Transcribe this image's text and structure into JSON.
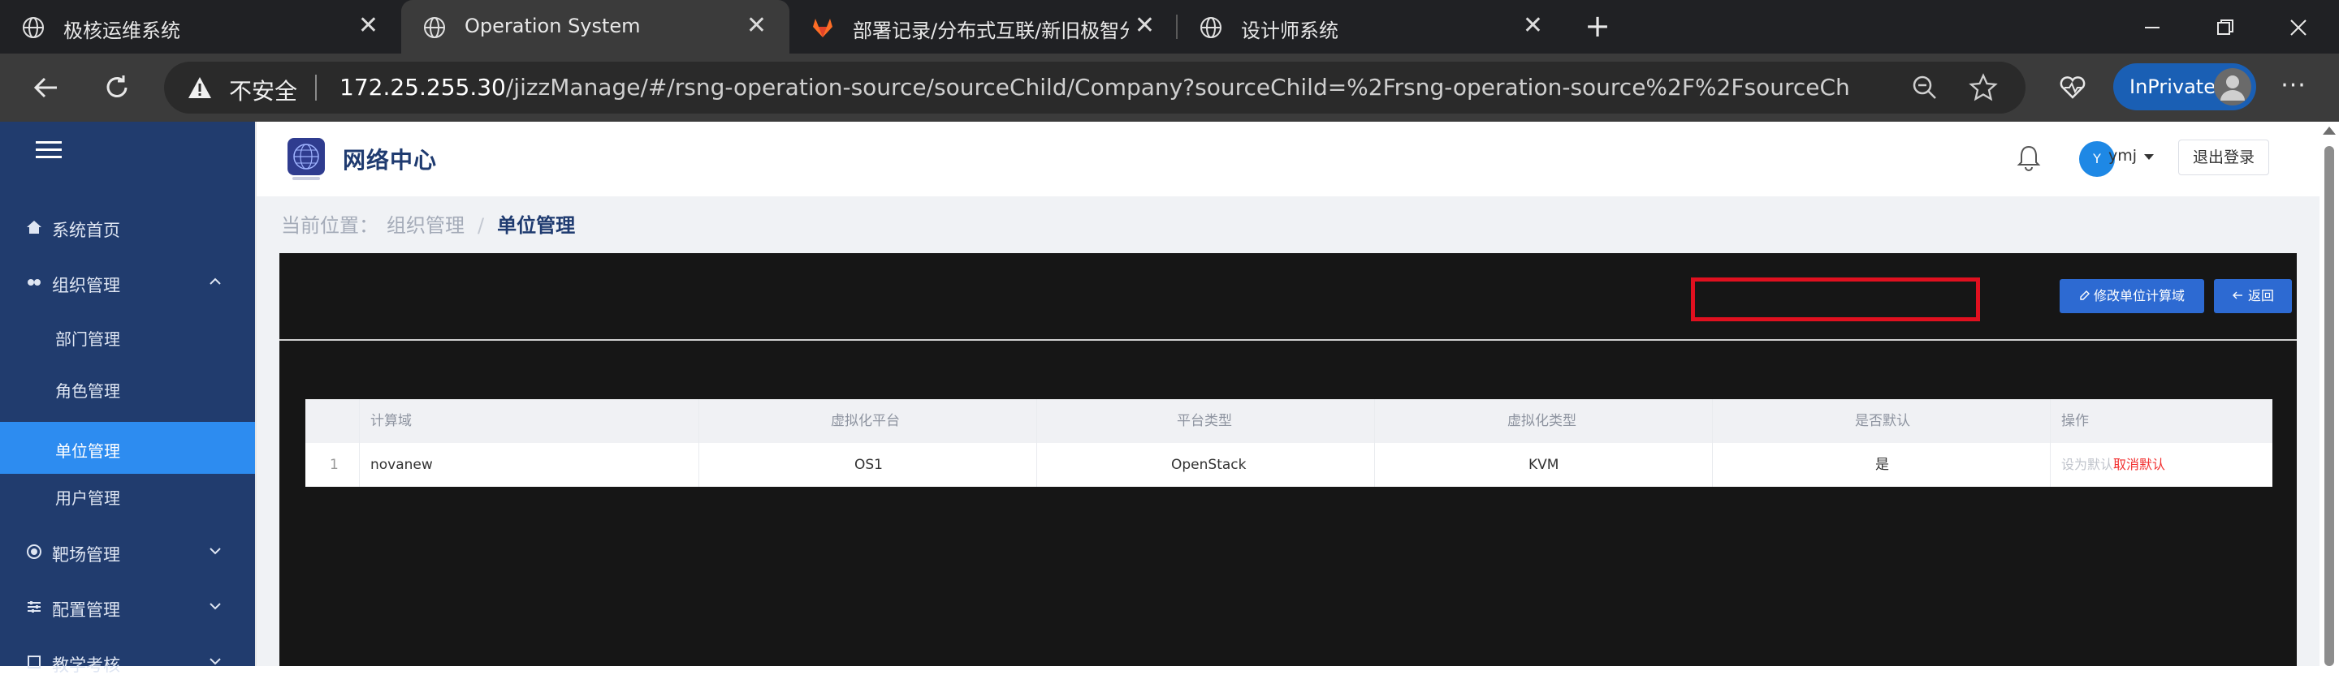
{
  "browser": {
    "tabs": [
      {
        "title": "极核运维系统",
        "icon": "globe-icon",
        "active": false
      },
      {
        "title": "Operation System",
        "icon": "globe-icon",
        "active": true
      },
      {
        "title": "部署记录/分布式互联/新旧极智分",
        "icon": "gitlab-icon",
        "active": false
      },
      {
        "title": "设计师系统",
        "icon": "globe-icon",
        "active": false
      }
    ],
    "close_glyph": "✕",
    "new_tab_glyph": "+",
    "address": {
      "security_label": "不安全",
      "url_host": "172.25.255.30",
      "url_path": "/jizzManage/#/rsng-operation-source/sourceChild/Company?sourceChild=%2Frsng-operation-source%2F%2FsourceChild%23%2FCompa..."
    },
    "inprivate_label": "InPrivate"
  },
  "app": {
    "brand": "网络中心",
    "user": {
      "avatar_letter": "Y",
      "name": "ymj"
    },
    "logout_label": "退出登录",
    "sidebar": {
      "items": [
        {
          "label": "系统首页",
          "icon": "home-icon"
        },
        {
          "label": "组织管理",
          "icon": "org-icon",
          "expanded": true,
          "children": [
            {
              "label": "部门管理"
            },
            {
              "label": "角色管理"
            },
            {
              "label": "单位管理",
              "active": true
            },
            {
              "label": "用户管理"
            }
          ]
        },
        {
          "label": "靶场管理",
          "icon": "target-icon",
          "expanded": false
        },
        {
          "label": "配置管理",
          "icon": "sliders-icon",
          "expanded": false
        },
        {
          "label": "教学考核",
          "icon": "book-icon",
          "expanded": false
        }
      ]
    },
    "breadcrumb": {
      "prefix": "当前位置：",
      "parent": "组织管理",
      "separator": "/",
      "current": "单位管理"
    },
    "actions": {
      "edit_domain_label": "修改单位计算域",
      "back_label": "返回"
    },
    "table": {
      "columns": [
        "",
        "计算域",
        "虚拟化平台",
        "平台类型",
        "虚拟化类型",
        "是否默认",
        "操作"
      ],
      "rows": [
        {
          "index": "1",
          "domain": "novanew",
          "platform": "OS1",
          "platform_type": "OpenStack",
          "virt_type": "KVM",
          "is_default": "是",
          "op_set_default": "设为默认",
          "op_cancel_default": "取消默认"
        }
      ]
    },
    "colors": {
      "sidebar_bg": "#213c6e",
      "active_item": "#2d8cf0",
      "primary_button": "#2d6ad2",
      "highlight_box": "#e0101f",
      "danger_text": "#f23030"
    }
  }
}
